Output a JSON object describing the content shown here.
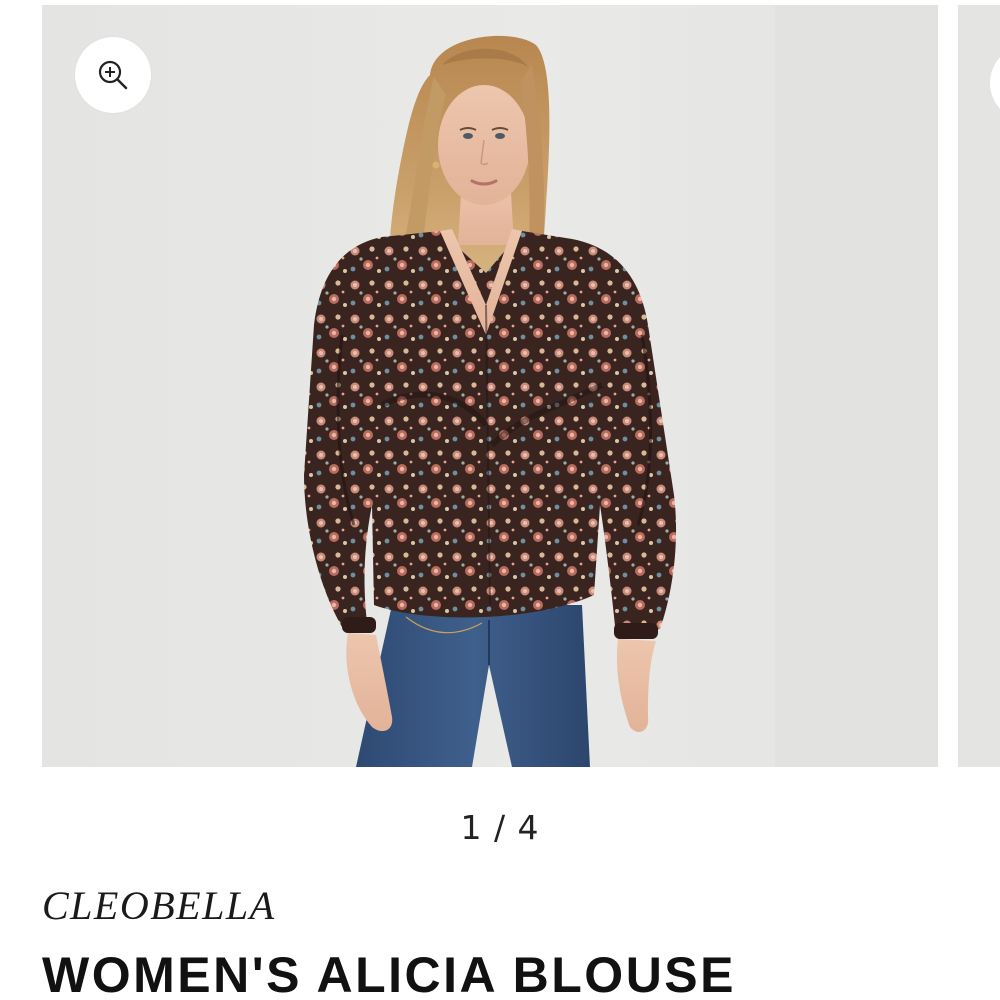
{
  "carousel": {
    "current": 1,
    "total": 4,
    "counter_text": "1 / 4",
    "zoom_icon": "zoom-in-icon",
    "background_color": "#e6e6e4"
  },
  "product": {
    "brand": "CLEOBELLA",
    "title": "WOMEN'S ALICIA BLOUSE",
    "blouse_color": "#3a2420",
    "jeans_color": "#35507a"
  }
}
